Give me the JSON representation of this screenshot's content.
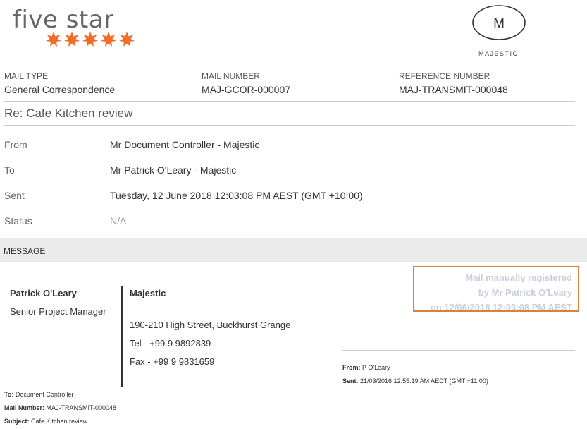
{
  "brand": {
    "name": "five star",
    "star_color": "#f26b2a",
    "star_count": 5,
    "partner_letter": "M",
    "partner_name": "MAJESTIC"
  },
  "meta": {
    "mail_type_label": "MAIL TYPE",
    "mail_type_value": "General Correspondence",
    "mail_number_label": "MAIL NUMBER",
    "mail_number_value": "MAJ-GCOR-000007",
    "reference_label": "REFERENCE NUMBER",
    "reference_value": "MAJ-TRANSMIT-000048"
  },
  "subject": "Re: Cafe Kitchen review",
  "details": {
    "from_label": "From",
    "from_value": "Mr Document Controller - Majestic",
    "to_label": "To",
    "to_value": "Mr Patrick O'Leary - Majestic",
    "sent_label": "Sent",
    "sent_value": "Tuesday, 12 June 2018 12:03:08 PM AEST (GMT +10:00)",
    "status_label": "Status",
    "status_value": "N/A"
  },
  "message": {
    "section_label": "MESSAGE",
    "registered": {
      "line1": "Mail manually registered",
      "line2": "by Mr Patrick O'Leary",
      "line3": "on 12/06/2018 12:03:08 PM AEST",
      "border_color": "#d9823b"
    },
    "signature": {
      "name": "Patrick O'Leary",
      "title": "Senior Project Manager",
      "company": "Majestic",
      "address": "190-210 High Street, Buckhurst Grange",
      "tel": "Tel - +99 9 9892839",
      "fax": "Fax - +99 9 9831659"
    },
    "forwarded": {
      "from_label": "From:",
      "from_value": "P O'Leary",
      "sent_label": "Sent:",
      "sent_value": "21/03/2016 12:55:19 AM AEDT (GMT +11:00)"
    },
    "original": {
      "to_label": "To:",
      "to_value": "Document Controller",
      "mail_number_label": "Mail Number:",
      "mail_number_value": "MAJ-TRANSMIT-000048",
      "subject_label": "Subject:",
      "subject_value": "Cafe Kitchen review"
    }
  }
}
